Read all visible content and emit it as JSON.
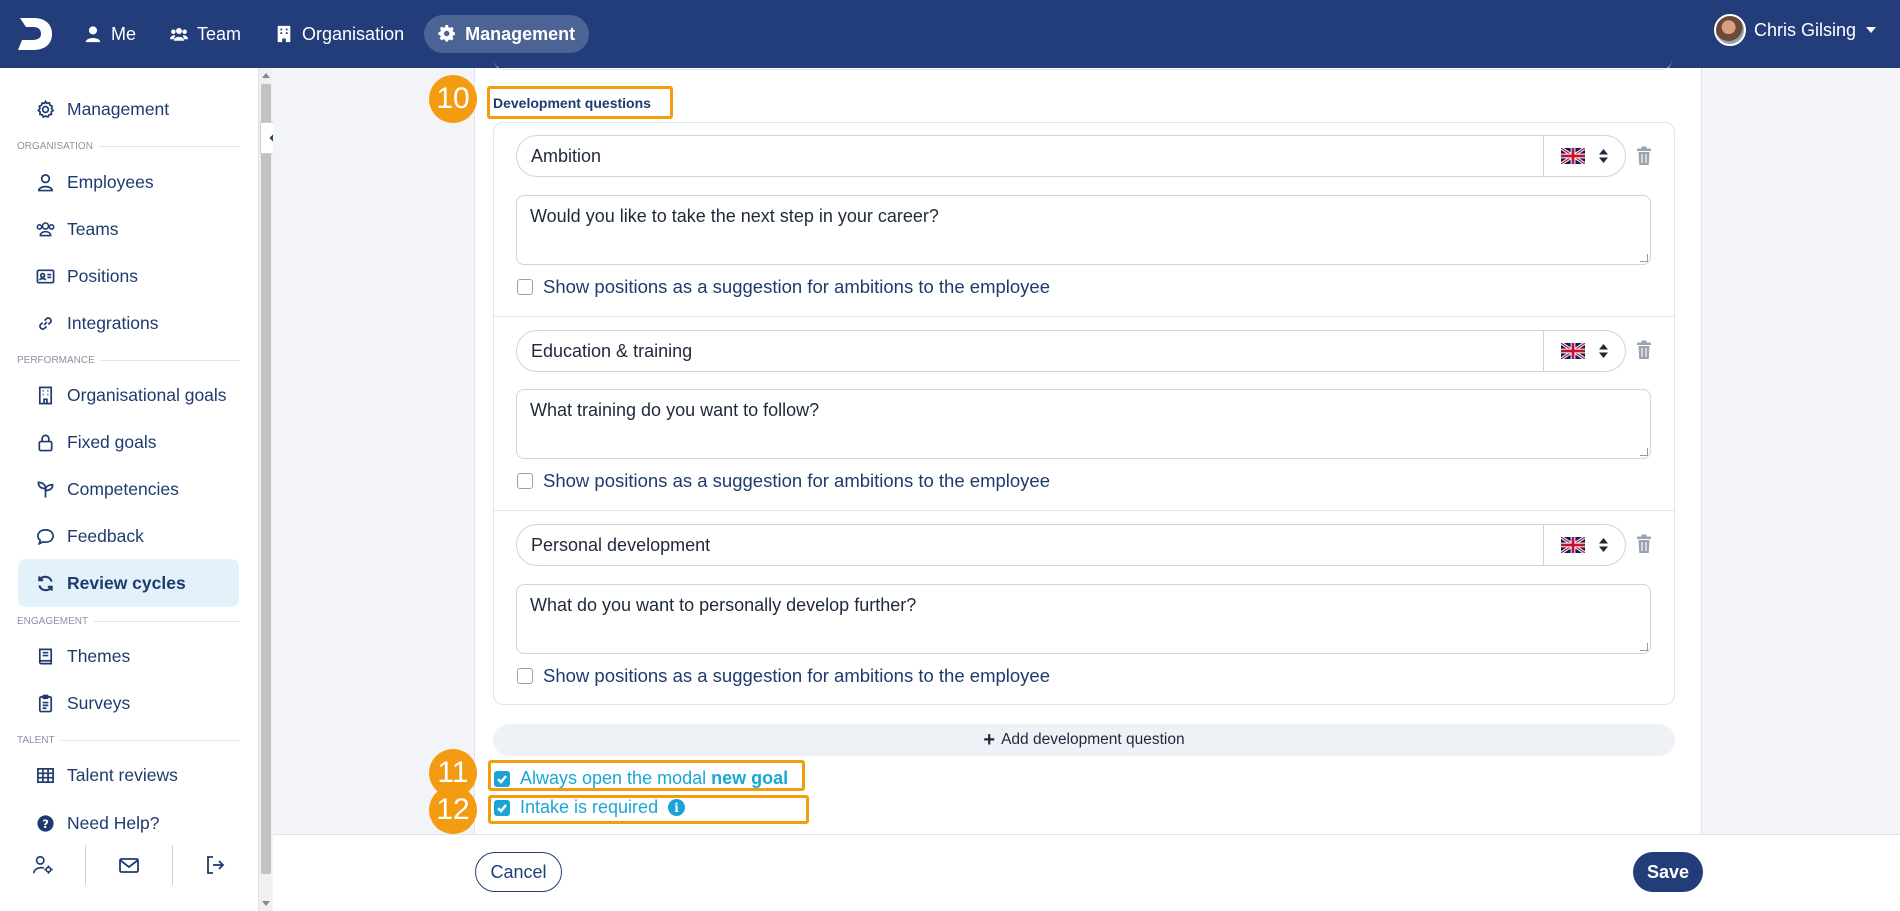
{
  "topnav": {
    "items": [
      {
        "label": "Me",
        "icon": "user-icon"
      },
      {
        "label": "Team",
        "icon": "users-icon"
      },
      {
        "label": "Organisation",
        "icon": "building-icon"
      },
      {
        "label": "Management",
        "icon": "gear-icon",
        "active": true
      }
    ],
    "user_name": "Chris Gilsing"
  },
  "sidebar": {
    "top_item": "Management",
    "sections": {
      "organisation": "ORGANISATION",
      "performance": "PERFORMANCE",
      "engagement": "ENGAGEMENT",
      "talent": "TALENT"
    },
    "organisation_items": [
      "Employees",
      "Teams",
      "Positions",
      "Integrations"
    ],
    "performance_items": [
      "Organisational goals",
      "Fixed goals",
      "Competencies",
      "Feedback",
      "Review cycles"
    ],
    "engagement_items": [
      "Themes",
      "Surveys"
    ],
    "talent_items": [
      "Talent reviews"
    ],
    "help": "Need Help?",
    "active_item": "Review cycles"
  },
  "main": {
    "section_title": "Development questions",
    "badges": [
      "10",
      "11",
      "12"
    ],
    "questions": [
      {
        "title": "Ambition",
        "text": "Would you like to take the next step in your career?",
        "checkbox_label": "Show positions as a suggestion for ambitions to the employee",
        "checked": false
      },
      {
        "title": "Education & training",
        "text": "What training do you want to follow?",
        "checkbox_label": "Show positions as a suggestion for ambitions to the employee",
        "checked": false
      },
      {
        "title": "Personal development",
        "text": "What do you want to personally develop further?",
        "checkbox_label": "Show positions as a suggestion for ambitions to the employee",
        "checked": false
      }
    ],
    "add_question_label": "Add development question",
    "option_modal_prefix": "Always open the modal ",
    "option_modal_bold": "new goal",
    "option_modal_checked": true,
    "option_intake_label": "Intake is required",
    "option_intake_checked": true
  },
  "footer": {
    "cancel_label": "Cancel",
    "save_label": "Save"
  },
  "colors": {
    "brand_navy": "#233c7a",
    "accent_cyan": "#1aa3d4",
    "highlight_orange": "#f39c12",
    "active_bg": "#e3f1fb"
  }
}
